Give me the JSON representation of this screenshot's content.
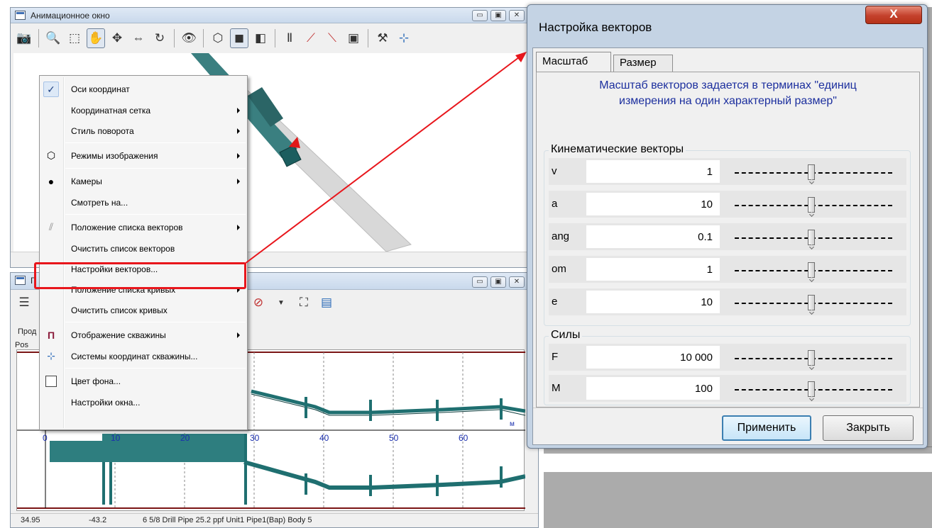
{
  "anim_window": {
    "title": "Анимационное окно",
    "cap_minimize": "▭",
    "cap_maximize": "▣",
    "cap_close": "✕"
  },
  "graph_window": {
    "title_short": "Г",
    "group_prod": "Прод",
    "group_pos": "Pos",
    "axis_unit": "м",
    "ticks": [
      "0",
      "10",
      "20",
      "30",
      "40",
      "50",
      "60"
    ],
    "status": [
      "34.95",
      "-43.2",
      "6 5/8 Drill Pipe 25.2 ppf Unit1 Pipe1(Bap) Body 5"
    ]
  },
  "context_menu": {
    "items": [
      {
        "label": "Оси координат",
        "icon": "check-icon",
        "submenu": false
      },
      {
        "label": "Координатная сетка",
        "icon": "",
        "submenu": true
      },
      {
        "label": "Стиль поворота",
        "icon": "",
        "submenu": true
      },
      {
        "label": "Режимы изображения",
        "icon": "cube-mode-icon",
        "submenu": true
      },
      {
        "label": "Камеры",
        "icon": "eye-icon",
        "submenu": true
      },
      {
        "label": "Смотреть на...",
        "icon": "",
        "submenu": false
      },
      {
        "label": "Положение списка векторов",
        "icon": "vectors-icon",
        "submenu": true
      },
      {
        "label": "Очистить список векторов",
        "icon": "",
        "submenu": false
      },
      {
        "label": "Настройки векторов...",
        "icon": "",
        "submenu": false
      },
      {
        "label": "Положение списка кривых",
        "icon": "",
        "submenu": true
      },
      {
        "label": "Очистить список кривых",
        "icon": "",
        "submenu": false
      },
      {
        "label": "Отображение скважины",
        "icon": "well-icon",
        "submenu": true
      },
      {
        "label": "Системы координат скважины...",
        "icon": "axes-icon",
        "submenu": false
      },
      {
        "label": "Цвет фона...",
        "icon": "color-box-icon",
        "submenu": false
      },
      {
        "label": "Настройки окна...",
        "icon": "",
        "submenu": false
      }
    ]
  },
  "dialog": {
    "title": "Настройка векторов",
    "close_glyph": "X",
    "tabs": [
      "Масштаб",
      "Размер"
    ],
    "note_line1": "Масштаб векторов задается в терминах \"единиц",
    "note_line2": "измерения на один характерный размер\"",
    "kinematic_title": "Кинематические векторы",
    "kinematic_rows": [
      {
        "label": "v",
        "value": "1"
      },
      {
        "label": "a",
        "value": "10"
      },
      {
        "label": "ang",
        "value": "0.1"
      },
      {
        "label": "om",
        "value": "1"
      },
      {
        "label": "e",
        "value": "10"
      }
    ],
    "forces_title": "Силы",
    "force_rows": [
      {
        "label": "F",
        "value": "10 000"
      },
      {
        "label": "M",
        "value": "100"
      }
    ],
    "apply_label": "Применить",
    "close_label": "Закрыть"
  },
  "colors": {
    "highlight_red": "#e8161c",
    "pipe_teal": "#1f6f70",
    "note_blue": "#1c2f9e",
    "plot_border": "#7a1414"
  }
}
